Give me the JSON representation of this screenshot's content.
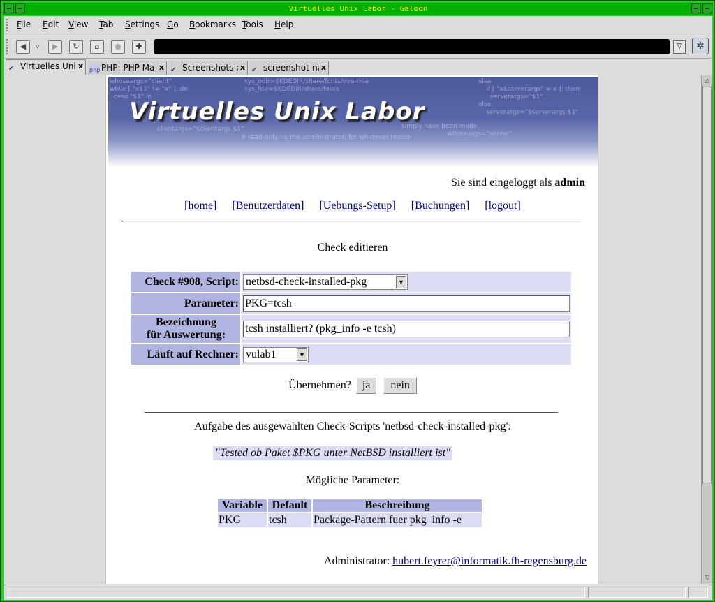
{
  "window": {
    "title": "Virtuelles Unix Labor - Galeon"
  },
  "menu": [
    "File",
    "Edit",
    "View",
    "Tab",
    "Settings",
    "Go",
    "Bookmarks",
    "Tools",
    "Help"
  ],
  "tabs": [
    {
      "label": "Virtuelles Unix",
      "icon": "galeon-icon",
      "close": "x"
    },
    {
      "label": "PHP: PHP Ma",
      "icon": "php-icon",
      "close": "x"
    },
    {
      "label": "Screenshots c",
      "icon": "galeon-icon",
      "close": "x"
    },
    {
      "label": "screenshot-na",
      "icon": "galeon-icon",
      "close": "x"
    }
  ],
  "page": {
    "banner_title": "Virtuelles Unix Labor",
    "login_prefix": "Sie sind eingeloggt als ",
    "login_user": "admin",
    "nav": [
      "[home]",
      "[Benutzerdaten]",
      "[Uebungs-Setup]",
      "[Buchungen]",
      "[logout]"
    ],
    "heading": "Check editieren",
    "form": {
      "check_label": "Check #908, Script:",
      "script_value": "netbsd-check-installed-pkg",
      "param_label": "Parameter:",
      "param_value": "PKG=tcsh",
      "bez_label_1": "Bezeichnung",
      "bez_label_2": "für Auswertung:",
      "bez_value": "tcsh installiert? (pkg_info -e tcsh)",
      "host_label": "Läuft auf Rechner:",
      "host_value": "vulab1"
    },
    "apply_prompt": "Übernehmen?",
    "btn_yes": "ja",
    "btn_no": "nein",
    "task_text": "Aufgabe des ausgewählten Check-Scripts 'netbsd-check-installed-pkg':",
    "description": "\"Tested ob Paket $PKG unter NetBSD installiert ist\"",
    "params_heading": "Mögliche Parameter:",
    "params_table": {
      "headers": [
        "Variable",
        "Default",
        "Beschreibung"
      ],
      "rows": [
        [
          "PKG",
          "tcsh",
          "Package-Pattern fuer pkg_info -e"
        ]
      ]
    },
    "admin_label": "Administrator: ",
    "admin_email": "hubert.feyrer@informatik.fh-regensburg.de"
  }
}
